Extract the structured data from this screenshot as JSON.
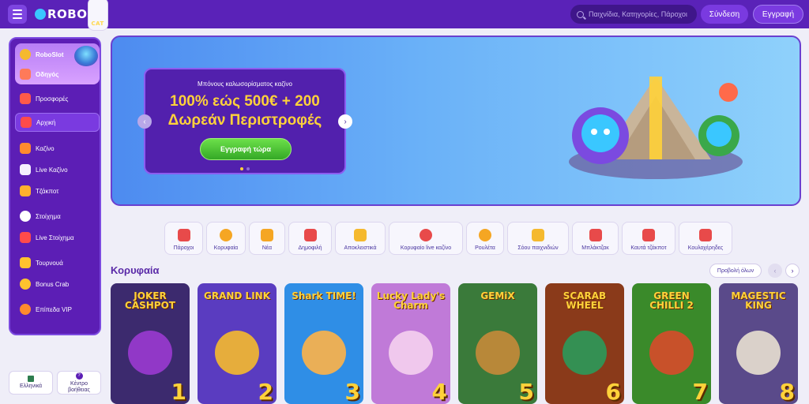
{
  "header": {
    "logo_text_1": "ROBO",
    "logo_text_2": "CAT",
    "search_placeholder": "Παιχνίδια, Κατηγορίες, Πάροχοι",
    "login_label": "Σύνδεση",
    "register_label": "Εγγραφή"
  },
  "sidebar": {
    "promo_items": [
      {
        "label": "RoboSlot",
        "icon": "slot-coin-icon",
        "color": "#f5b92e"
      },
      {
        "label": "Οδηγός",
        "icon": "guide-icon",
        "color": "#ff7a59"
      }
    ],
    "items": [
      {
        "label": "Προσφορές",
        "icon": "gift-icon",
        "color": "#ff5a4a"
      },
      {
        "label": "Αρχική",
        "icon": "home-icon",
        "color": "#ff4b4b",
        "active": true
      },
      {
        "label": "Καζίνο",
        "icon": "casino-icon",
        "color": "#ff8a2e"
      },
      {
        "label": "Live Καζίνο",
        "icon": "live-cards-icon",
        "color": "#f5f0ff"
      },
      {
        "label": "Τζάκποτ",
        "icon": "jackpot-icon",
        "color": "#ffb02e"
      },
      {
        "label": "Στοίχημα",
        "icon": "ball-icon",
        "color": "#ffffff"
      },
      {
        "label": "Live Στοίχημα",
        "icon": "live-bet-icon",
        "color": "#ff4b4b"
      },
      {
        "label": "Τουρνουά",
        "icon": "trophy-icon",
        "color": "#ffc22e"
      },
      {
        "label": "Bonus Crab",
        "icon": "crab-icon",
        "color": "#ffc22e"
      },
      {
        "label": "Επίπεδα VIP",
        "icon": "vip-icon",
        "color": "#ff8a2e"
      }
    ],
    "language_label": "Ελληνικά",
    "help_label_1": "Κέντρο",
    "help_label_2": "βοήθειας"
  },
  "banner": {
    "subtitle": "Μπόνους καλωσορίσματος καζίνο",
    "line1": "100% εώς 500€ + 200",
    "line2": "Δωρεάν Περιστροφές",
    "cta_label": "Εγγραφή τώρα",
    "slides": 2,
    "active_slide": 1
  },
  "categories": [
    {
      "label": "Πάροχοι",
      "icon": "providers-icon",
      "color": "#e84a4a"
    },
    {
      "label": "Κορυφαία",
      "icon": "medal-icon",
      "color": "#f5a623"
    },
    {
      "label": "Νέα",
      "icon": "bell-icon",
      "color": "#f5a623"
    },
    {
      "label": "Δημοφιλή",
      "icon": "star-icon",
      "color": "#e84a4a"
    },
    {
      "label": "Αποκλειστικά",
      "icon": "exclusive-icon",
      "color": "#f5b92e"
    },
    {
      "label": "Κορυφαίο live καζίνο",
      "icon": "chip-icon",
      "color": "#e84a4a"
    },
    {
      "label": "Ρουλέτα",
      "icon": "roulette-icon",
      "color": "#f5a623"
    },
    {
      "label": "Σόου παιχνιδιών",
      "icon": "show-icon",
      "color": "#f5b92e"
    },
    {
      "label": "Μπλάκτζακ",
      "icon": "cards-icon",
      "color": "#e84a4a"
    },
    {
      "label": "Καυτά τζάκποτ",
      "icon": "hot-jackpot-icon",
      "color": "#e84a4a"
    },
    {
      "label": "Κουλοχέρηδες",
      "icon": "slots-icon",
      "color": "#e84a4a"
    }
  ],
  "top_games": {
    "title": "Κορυφαία",
    "view_all_label": "Προβολή όλων",
    "games": [
      {
        "title": "JOKER CASHPOT",
        "rank": "1",
        "bg": "#3c2a6e",
        "art": "#9a3ad0"
      },
      {
        "title": "GRAND LINK",
        "rank": "2",
        "bg": "#5a3cc0",
        "art": "#f5b92e"
      },
      {
        "title": "Shark TIME!",
        "rank": "3",
        "bg": "#2f8ee6",
        "art": "#ffb347"
      },
      {
        "title": "Lucky Lady's Charm",
        "rank": "4",
        "bg": "#c07ad8",
        "art": "#f5d0f0"
      },
      {
        "title": "GEMiX",
        "rank": "5",
        "bg": "#3a7a3a",
        "art": "#c68a3a"
      },
      {
        "title": "SCARAB WHEEL",
        "rank": "6",
        "bg": "#8a3a1a",
        "art": "#2a9a5a"
      },
      {
        "title": "GREEN CHILLI 2",
        "rank": "7",
        "bg": "#3a8a2a",
        "art": "#d84a2a"
      },
      {
        "title": "MAGESTIC KING",
        "rank": "8",
        "bg": "#5a4a8a",
        "art": "#e8e0d0"
      }
    ]
  }
}
